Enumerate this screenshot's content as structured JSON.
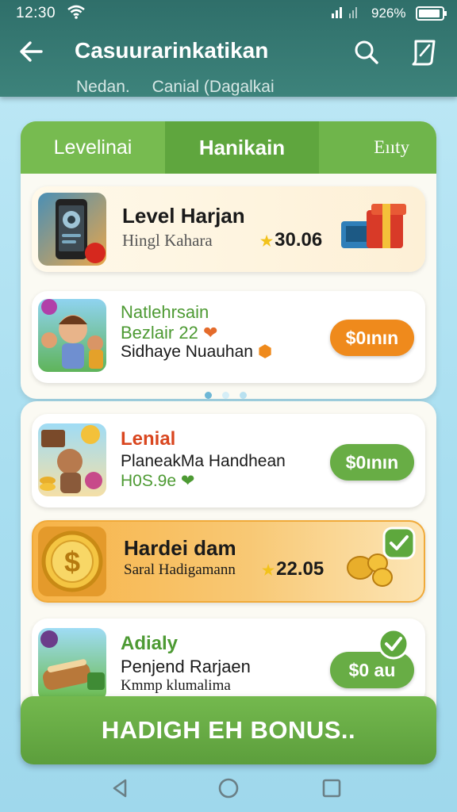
{
  "status_bar": {
    "time": "12:30",
    "battery": "926%"
  },
  "app_bar": {
    "title": "Casuurarinkatikan",
    "subtitles": [
      "Nedan.",
      "Canial (Dagalkai"
    ]
  },
  "tabs": [
    {
      "label": "Levelinai"
    },
    {
      "label": "Hanikain"
    },
    {
      "label": "Eııty"
    }
  ],
  "cards": [
    {
      "title": "Level Harjan",
      "line1": "Hingl Kahara",
      "value": "30.06",
      "badge": "!"
    },
    {
      "title": "Natlehrsain",
      "line1": "Bezlair 22",
      "line2": "Sidhaye Nuauhan",
      "button": "$0ının"
    },
    {
      "title": "Lenial",
      "line1": "PlaneakMa Handhean",
      "line2": "H0S.9e",
      "button": "$0ının"
    },
    {
      "title": "Hardei dam",
      "line1": "Saral Hadigamann",
      "value": "22.05"
    },
    {
      "title": "Adialy",
      "line1": "Penjend Rarjaen",
      "line2": "Kmmp klumalima",
      "button": "$0 au"
    }
  ],
  "bonus_button": {
    "label": "HADIGH EH BONUS.."
  },
  "colors": {
    "green": "#6fb54b",
    "orange": "#ef8a1c",
    "teal": "#3d837b",
    "gold": "#f6c05a"
  }
}
